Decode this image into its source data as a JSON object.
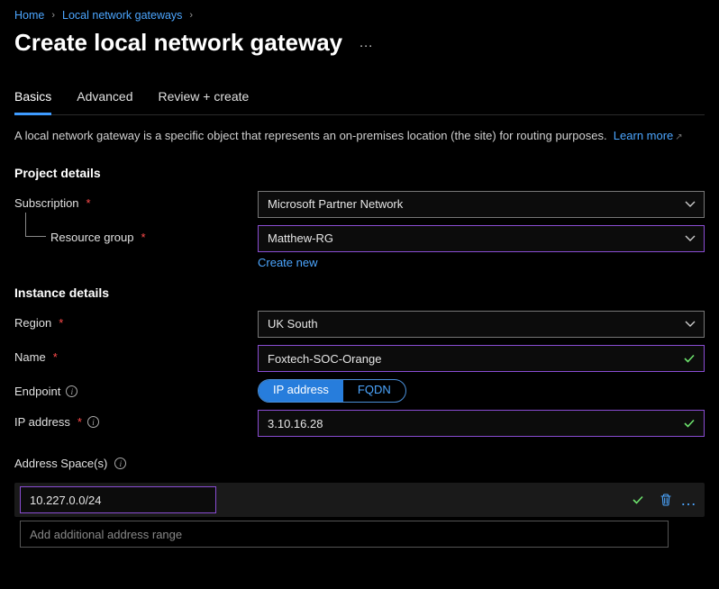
{
  "breadcrumb": {
    "home": "Home",
    "parent": "Local network gateways"
  },
  "page_title": "Create local network gateway",
  "tabs": {
    "basics": "Basics",
    "advanced": "Advanced",
    "review": "Review + create"
  },
  "description": "A local network gateway is a specific object that represents an on-premises location (the site) for routing purposes.",
  "learn_more": "Learn more",
  "sections": {
    "project": "Project details",
    "instance": "Instance details"
  },
  "fields": {
    "subscription": {
      "label": "Subscription",
      "value": "Microsoft Partner Network"
    },
    "resource_group": {
      "label": "Resource group",
      "value": "Matthew-RG",
      "create_new": "Create new"
    },
    "region": {
      "label": "Region",
      "value": "UK South"
    },
    "name": {
      "label": "Name",
      "value": "Foxtech-SOC-Orange"
    },
    "endpoint": {
      "label": "Endpoint",
      "options": {
        "ip": "IP address",
        "fqdn": "FQDN"
      }
    },
    "ip_address": {
      "label": "IP address",
      "value": "3.10.16.28"
    },
    "address_space": {
      "label": "Address Space(s)",
      "entries": [
        "10.227.0.0/24"
      ],
      "placeholder": "Add additional address range"
    }
  }
}
